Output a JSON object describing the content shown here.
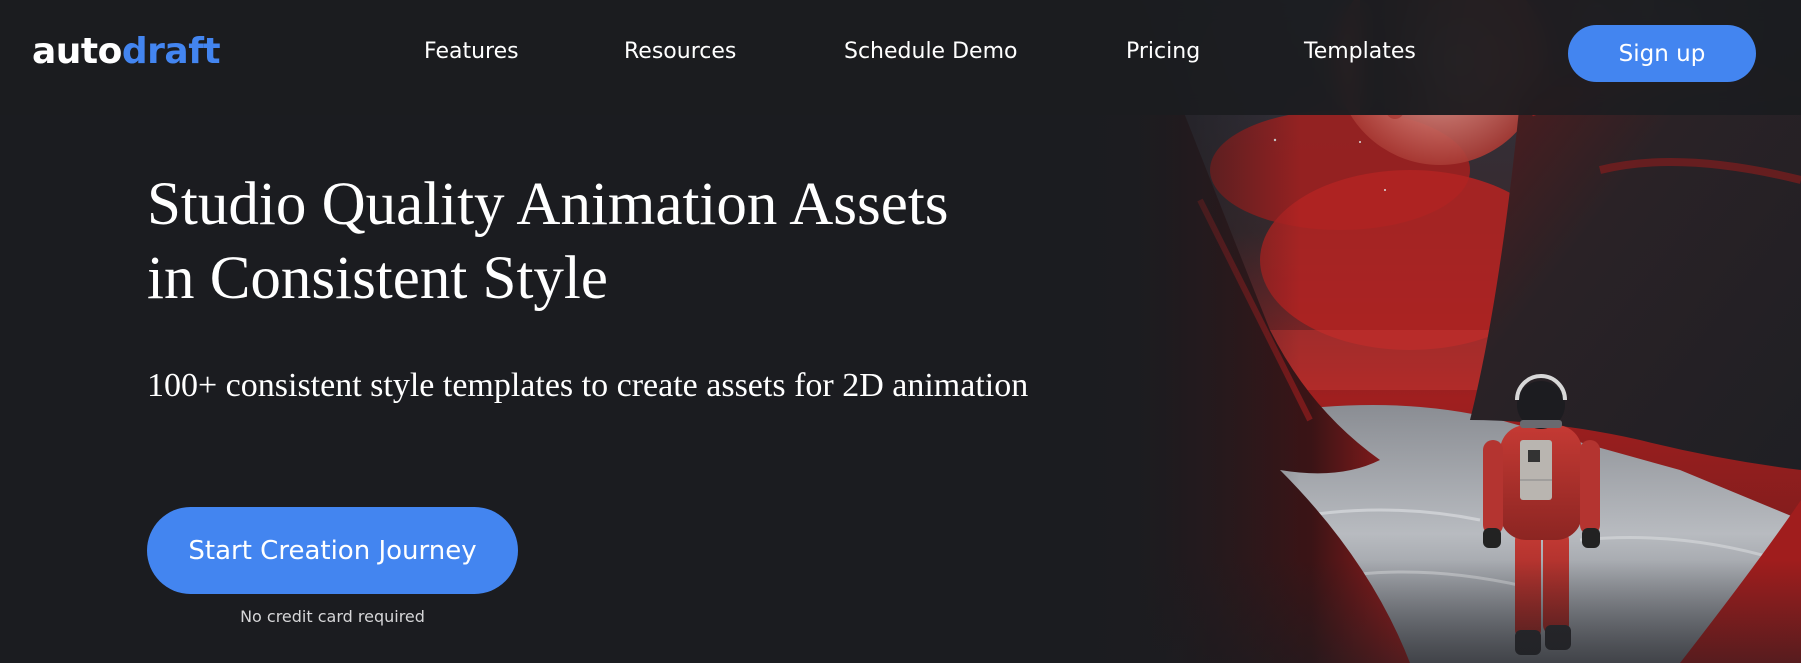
{
  "brand": {
    "logo_part1": "auto",
    "logo_part2": "draft",
    "accent_color": "#4385f0",
    "background_color": "#1b1c20"
  },
  "nav": {
    "items": [
      {
        "label": "Features"
      },
      {
        "label": "Resources"
      },
      {
        "label": "Schedule Demo"
      },
      {
        "label": "Pricing"
      },
      {
        "label": "Templates"
      }
    ],
    "signup_label": "Sign up"
  },
  "hero": {
    "title_line1": "Studio Quality Animation Assets",
    "title_line2": "in Consistent Style",
    "subtitle": "100+ consistent style templates to create assets for 2D animation",
    "cta_label": "Start Creation Journey",
    "cta_note": "No credit card required",
    "image_description": "astronaut-in-red-suit-walking-through-red-canyon-under-blood-moon"
  }
}
